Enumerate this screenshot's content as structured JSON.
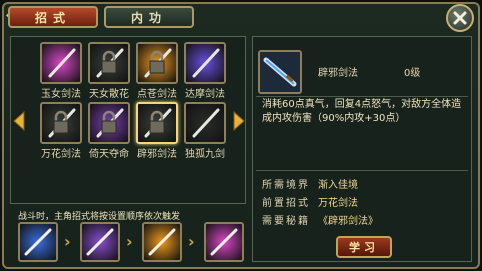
{
  "tabs": [
    {
      "label": "招式",
      "active": true
    },
    {
      "label": "内功",
      "active": false
    }
  ],
  "skills": [
    {
      "name": "玉女剑法",
      "icon": "jade-sword-icon",
      "locked": false,
      "color": "#d948c7"
    },
    {
      "name": "天女散花",
      "icon": "lock-icon",
      "locked": true,
      "color": "#3a3f3a"
    },
    {
      "name": "点苍剑法",
      "icon": "lock-icon",
      "locked": true,
      "color": "#ef9a1d"
    },
    {
      "name": "达摩剑法",
      "icon": "blue-sword-icon",
      "locked": false,
      "color": "#6a4fe0"
    },
    {
      "name": "万花剑法",
      "icon": "lock-icon",
      "locked": true,
      "color": "#3a3f3a"
    },
    {
      "name": "倚天夺命",
      "icon": "lock-icon",
      "locked": true,
      "color": "#7a3fb0"
    },
    {
      "name": "辟邪剑法",
      "icon": "lock-icon",
      "locked": true,
      "color": "#3a3f3a",
      "selected": true
    },
    {
      "name": "独孤九剑",
      "icon": "dark-sword-icon",
      "locked": false,
      "color": "#2a2d2a"
    }
  ],
  "hint": "战斗时，主角招式将按设置顺序依次触发",
  "sequence": [
    {
      "icon": "blue-sword-icon",
      "color": "#3a6fe0"
    },
    {
      "icon": "purple-sword-icon",
      "color": "#8a4fd0"
    },
    {
      "icon": "gold-sword-icon",
      "color": "#ef9a1d"
    },
    {
      "icon": "pink-sword-icon",
      "color": "#d948c7"
    }
  ],
  "detail": {
    "name": "辟邪剑法",
    "level": "0级",
    "description": "消耗60点真气，回复4点怒气，对敌方全体造成内攻伤害（90%内攻+30点）",
    "realm_label": "所需境界",
    "realm_value": "渐入佳境",
    "prereq_label": "前置招式",
    "prereq_value": "万花剑法",
    "book_label": "需要秘籍",
    "book_value": "《辟邪剑法》"
  },
  "learn_button": "学习",
  "colors": {
    "accent": "#f3d676",
    "frame": "#8a7a52",
    "panel": "#16221b"
  }
}
